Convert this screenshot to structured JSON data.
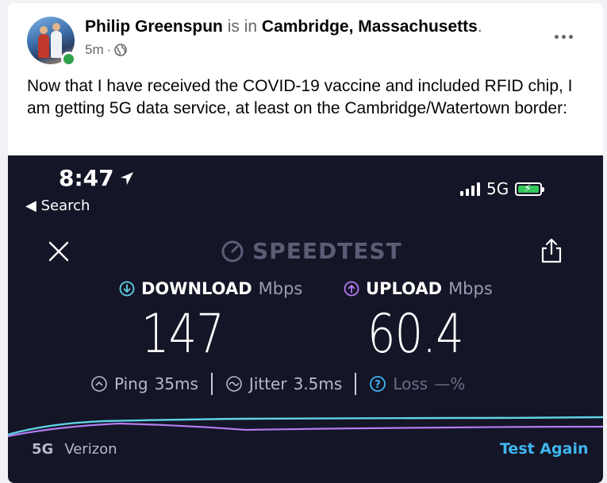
{
  "post": {
    "author": "Philip Greenspun",
    "connector": "is in",
    "location": "Cambridge, Massachusetts",
    "period": ".",
    "time_ago": "5m",
    "separator": "·",
    "privacy_icon": "globe-icon",
    "more_icon": "more-options-icon",
    "text": "Now that I have received the COVID-19 vaccine and included RFID chip, I am getting 5G data service, at least on the Cambridge/Watertown border:"
  },
  "phone": {
    "time": "8:47",
    "back_label": "◀ Search",
    "network": "5G",
    "app_name": "SPEEDTEST",
    "download": {
      "label": "DOWNLOAD",
      "unit": "Mbps",
      "value": "147"
    },
    "upload": {
      "label": "UPLOAD",
      "unit": "Mbps",
      "value": "60.4"
    },
    "ping": {
      "label": "Ping",
      "value": "35",
      "unit": "ms"
    },
    "jitter": {
      "label": "Jitter",
      "value": "3.5",
      "unit": "ms"
    },
    "loss": {
      "label": "Loss",
      "value": "—",
      "unit": "%"
    },
    "provider_tech": "5G",
    "provider_name": "Verizon",
    "test_again": "Test Again"
  },
  "colors": {
    "download_accent": "#5fd3e6",
    "upload_accent": "#b47cf0",
    "link": "#3fb6f0",
    "online": "#31a24c"
  }
}
